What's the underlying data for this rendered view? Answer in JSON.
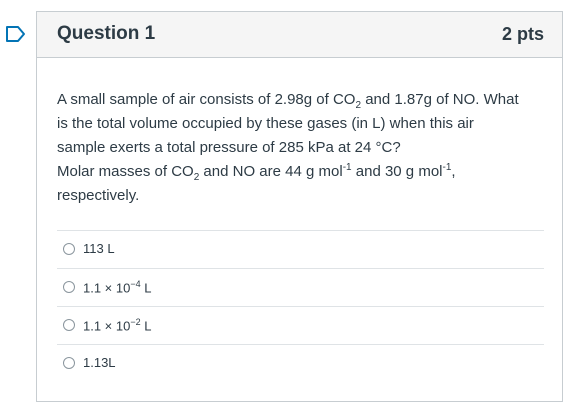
{
  "question": {
    "title": "Question 1",
    "points": "2 pts",
    "text": {
      "l1_a": "A small sample of air consists of 2.98g of CO",
      "l1_sub": "2",
      "l1_b": " and 1.87g of NO. What",
      "l2": "is the total volume occupied by these gases (in L) when this air",
      "l3": "sample exerts a total pressure of 285 kPa at 24 °C?",
      "l4_a": "Molar masses of CO",
      "l4_sub": "2",
      "l4_b": " and NO are 44 g mol",
      "l4_sup1": "-1",
      "l4_c": " and 30 g mol",
      "l4_sup2": "-1",
      "l4_d": ",",
      "l5": "respectively."
    }
  },
  "answers": [
    {
      "text": "113 L"
    },
    {
      "base": "1.1 × 10",
      "exp": "−4",
      "unit": " L"
    },
    {
      "base": "1.1 × 10",
      "exp": "−2",
      "unit": " L"
    },
    {
      "text": "1.13L"
    }
  ],
  "colors": {
    "flag_accent": "#0374b5",
    "border": "#c7cdd1",
    "header_bg": "#f5f5f5",
    "text": "#2d3b45"
  },
  "icons": {
    "flag": "flag-outline-icon"
  }
}
